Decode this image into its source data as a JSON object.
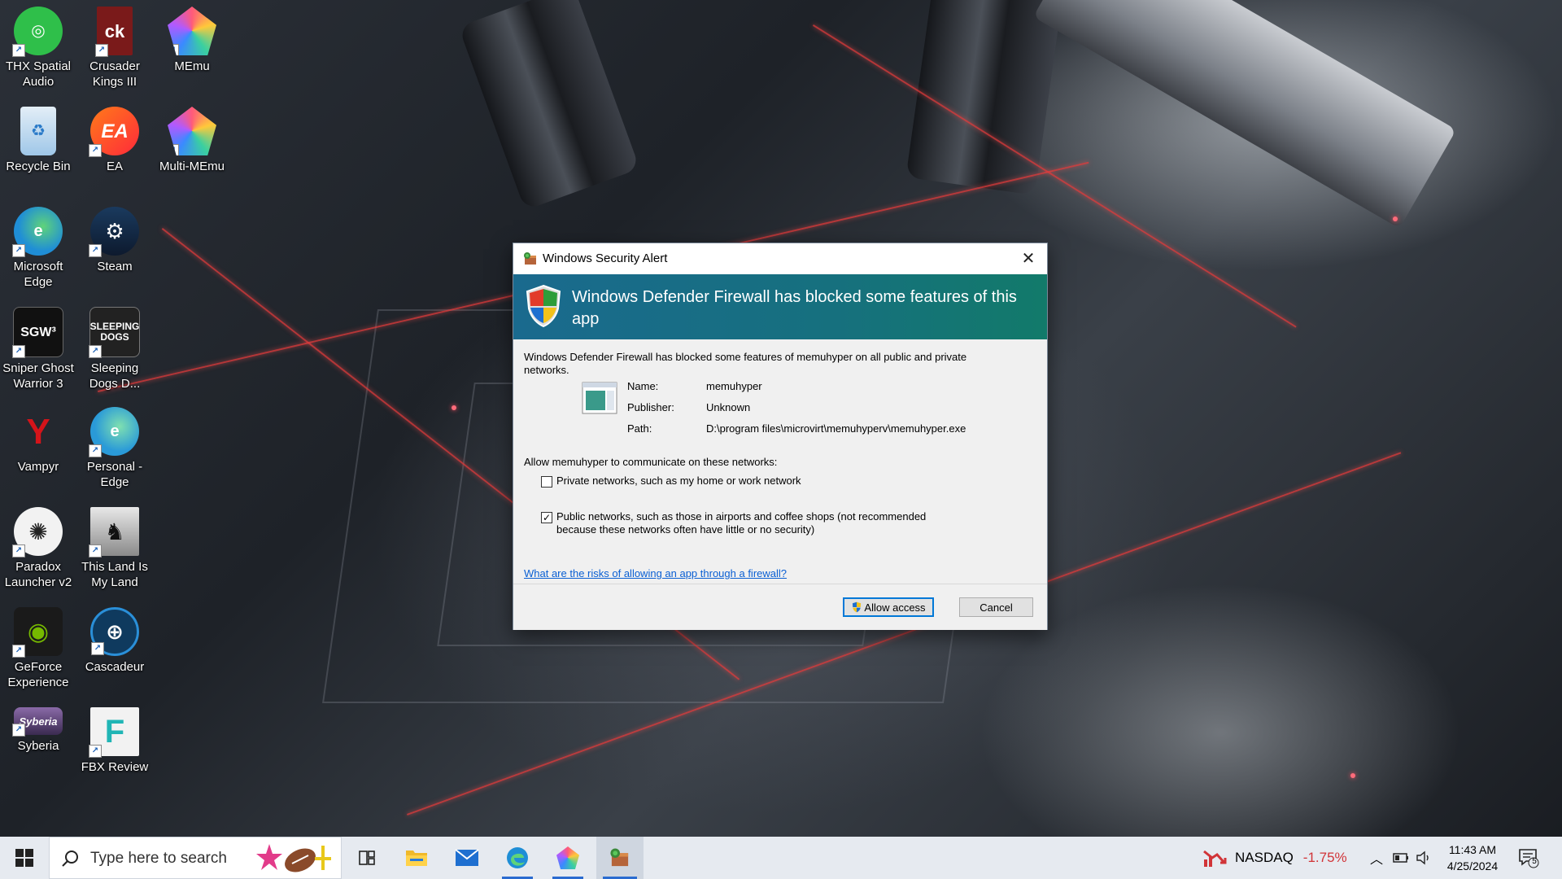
{
  "desktop": {
    "icons": [
      {
        "label": "THX Spatial Audio",
        "icon": "thx-icon",
        "color": "#2fbf4a"
      },
      {
        "label": "Recycle Bin",
        "icon": "recycle-bin-icon",
        "color": "#9fc7e8"
      },
      {
        "label": "Microsoft Edge",
        "icon": "edge-icon",
        "color": "#1f8ed6"
      },
      {
        "label": "Sniper Ghost Warrior 3",
        "icon": "sgw3-icon",
        "color": "#111111"
      },
      {
        "label": "Vampyr",
        "icon": "vampyr-icon",
        "color": "#b81212"
      },
      {
        "label": "Paradox Launcher v2",
        "icon": "paradox-icon",
        "color": "#2a2a2a"
      },
      {
        "label": "GeForce Experience",
        "icon": "geforce-icon",
        "color": "#76b900"
      },
      {
        "label": "Syberia",
        "icon": "syberia-icon",
        "color": "#6a4a86"
      },
      {
        "label": "Crusader Kings III",
        "icon": "crusader-kings-icon",
        "color": "#7a1a1a"
      },
      {
        "label": "EA",
        "icon": "ea-icon",
        "color": "#ff4d1a"
      },
      {
        "label": "Steam",
        "icon": "steam-icon",
        "color": "#16314f"
      },
      {
        "label": "Sleeping Dogs D...",
        "icon": "sleeping-dogs-icon",
        "color": "#2a2a2a"
      },
      {
        "label": "Personal - Edge",
        "icon": "edge-personal-icon",
        "color": "#2a9ad8"
      },
      {
        "label": "This Land Is My Land",
        "icon": "this-land-icon",
        "color": "#dcdcdc"
      },
      {
        "label": "Cascadeur",
        "icon": "cascadeur-icon",
        "color": "#1d7fc4"
      },
      {
        "label": "FBX Review",
        "icon": "fbx-review-icon",
        "color": "#20b5b5"
      },
      {
        "label": "MEmu",
        "icon": "memu-icon",
        "color": "#6b6cf0"
      },
      {
        "label": "Multi-MEmu",
        "icon": "multi-memu-icon",
        "color": "#6b6cf0"
      }
    ]
  },
  "dialog": {
    "title": "Windows Security Alert",
    "close_glyph": "✕",
    "banner": "Windows Defender Firewall has blocked some features of this app",
    "intro": "Windows Defender Firewall has blocked some features of memuhyper on all public and private networks.",
    "name_label": "Name:",
    "name_value": "memuhyper",
    "publisher_label": "Publisher:",
    "publisher_value": "Unknown",
    "path_label": "Path:",
    "path_value": "D:\\program files\\microvirt\\memuhyperv\\memuhyper.exe",
    "allow_heading": "Allow memuhyper to communicate on these networks:",
    "private_label": "Private networks, such as my home or work network",
    "private_checked": false,
    "public_label_1": "Public networks, such as those in airports and coffee shops (not recommended",
    "public_label_2": "because these networks often have little or no security)",
    "public_checked": true,
    "check_glyph": "✓",
    "link": "What are the risks of allowing an app through a firewall?",
    "allow_button": "Allow access",
    "cancel_button": "Cancel",
    "banner_color": "#1a6a8e"
  },
  "taskbar": {
    "search_placeholder": "Type here to search",
    "stock_name": "NASDAQ",
    "stock_change": "-1.75%",
    "stock_color": "#d13438",
    "time": "11:43 AM",
    "date": "4/25/2024",
    "notification_count": "5",
    "apps": [
      "task-view-icon",
      "file-explorer-icon",
      "mail-icon",
      "edge-icon",
      "memu-icon",
      "windows-security-icon"
    ]
  }
}
